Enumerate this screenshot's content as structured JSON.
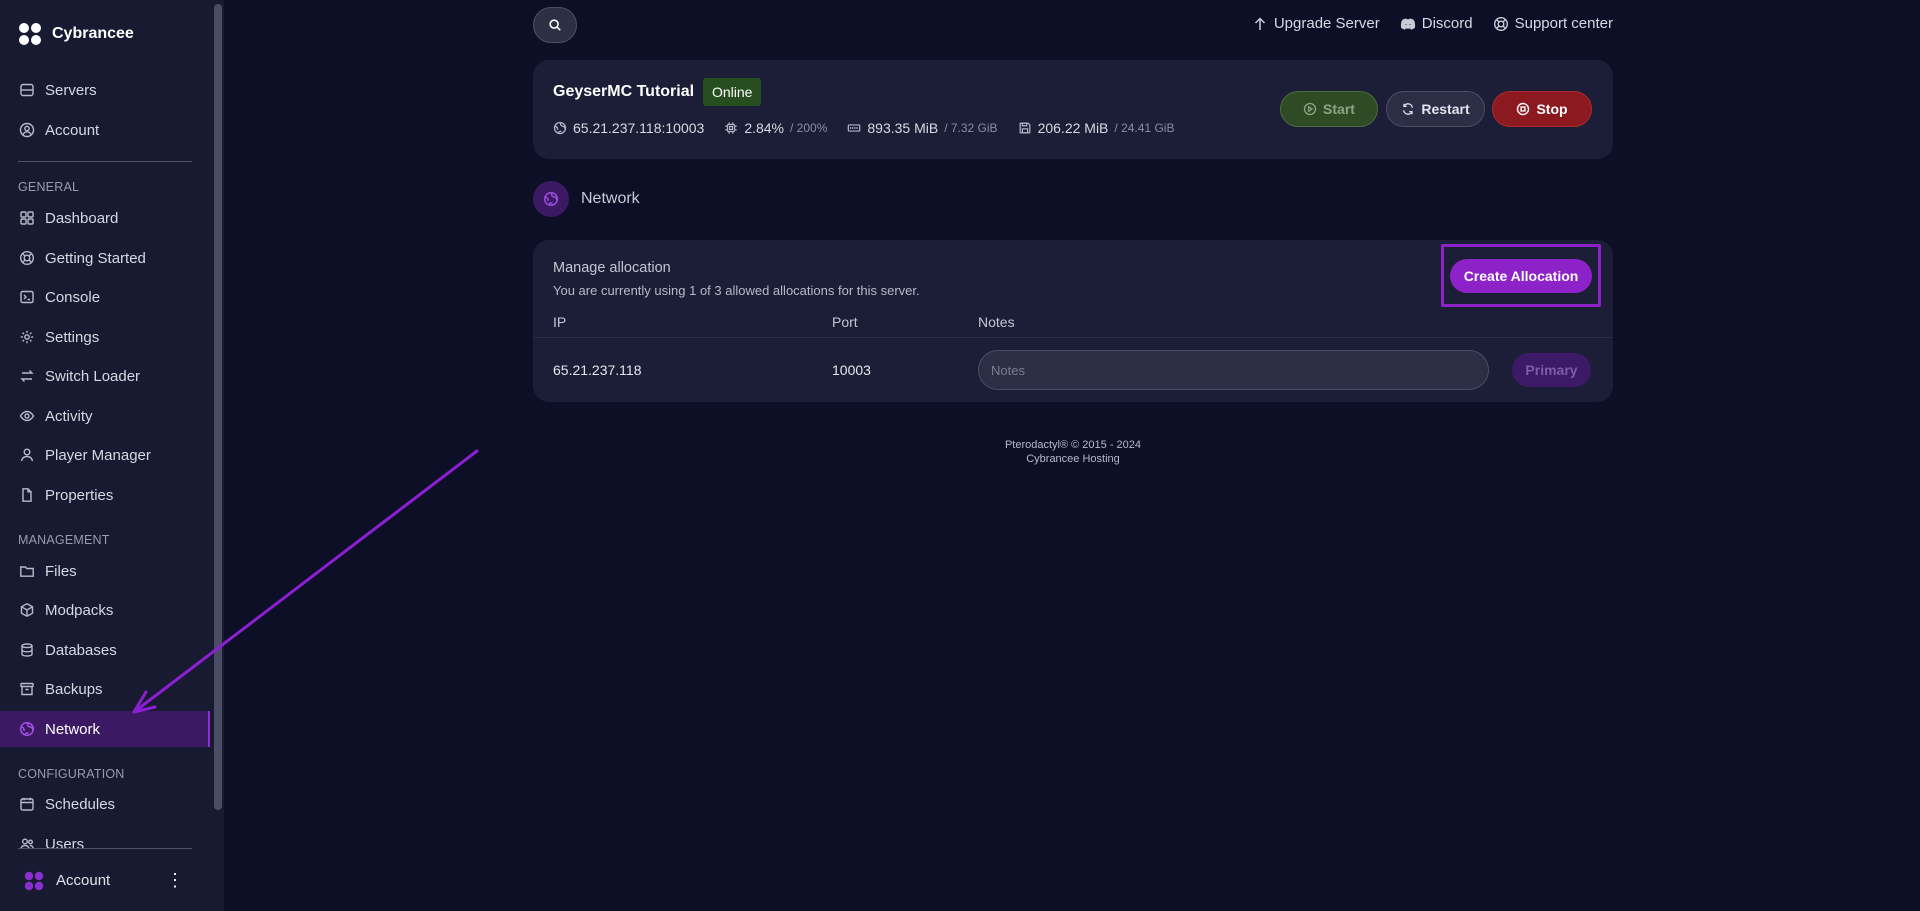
{
  "brand": {
    "name": "Cybrancee"
  },
  "sidebar": {
    "top_items": [
      {
        "label": "Servers",
        "icon": "server-icon"
      },
      {
        "label": "Account",
        "icon": "user-circle-icon"
      }
    ],
    "sections": {
      "general": "GENERAL",
      "management": "MANAGEMENT",
      "configuration": "CONFIGURATION"
    },
    "general_items": [
      {
        "label": "Dashboard",
        "icon": "grid-icon"
      },
      {
        "label": "Getting Started",
        "icon": "lifebuoy-icon"
      },
      {
        "label": "Console",
        "icon": "terminal-icon"
      },
      {
        "label": "Settings",
        "icon": "gear-icon"
      },
      {
        "label": "Switch Loader",
        "icon": "swap-icon"
      },
      {
        "label": "Activity",
        "icon": "eye-icon"
      },
      {
        "label": "Player Manager",
        "icon": "person-icon"
      },
      {
        "label": "Properties",
        "icon": "file-icon"
      }
    ],
    "management_items": [
      {
        "label": "Files",
        "icon": "folder-icon"
      },
      {
        "label": "Modpacks",
        "icon": "cube-icon"
      },
      {
        "label": "Databases",
        "icon": "database-icon"
      },
      {
        "label": "Backups",
        "icon": "archive-icon"
      },
      {
        "label": "Network",
        "icon": "globe-icon",
        "active": true
      }
    ],
    "configuration_items": [
      {
        "label": "Schedules",
        "icon": "calendar-icon"
      },
      {
        "label": "Users",
        "icon": "users-icon"
      }
    ],
    "account_label": "Account",
    "accent": "#8b2fd1"
  },
  "topbar": {
    "upgrade": "Upgrade Server",
    "discord": "Discord",
    "support": "Support center"
  },
  "server": {
    "name": "GeyserMC Tutorial",
    "status": "Online",
    "address": "65.21.237.118:10003",
    "cpu": "2.84%",
    "cpu_limit": "/ 200%",
    "memory": "893.35 MiB",
    "memory_limit": "/ 7.32 GiB",
    "disk": "206.22 MiB",
    "disk_limit": "/ 24.41 GiB",
    "buttons": {
      "start": "Start",
      "restart": "Restart",
      "stop": "Stop"
    }
  },
  "network": {
    "title": "Network",
    "manage_title": "Manage allocation",
    "description": "You are currently using 1 of 3 allowed allocations for this server.",
    "create_button": "Create Allocation",
    "columns": {
      "ip": "IP",
      "port": "Port",
      "notes": "Notes"
    },
    "rows": [
      {
        "ip": "65.21.237.118",
        "port": "10003",
        "notes_placeholder": "Notes",
        "badge": "Primary"
      }
    ]
  },
  "footer": {
    "line1": "Pterodactyl® © 2015 - 2024",
    "line2": "Cybrancee Hosting"
  }
}
